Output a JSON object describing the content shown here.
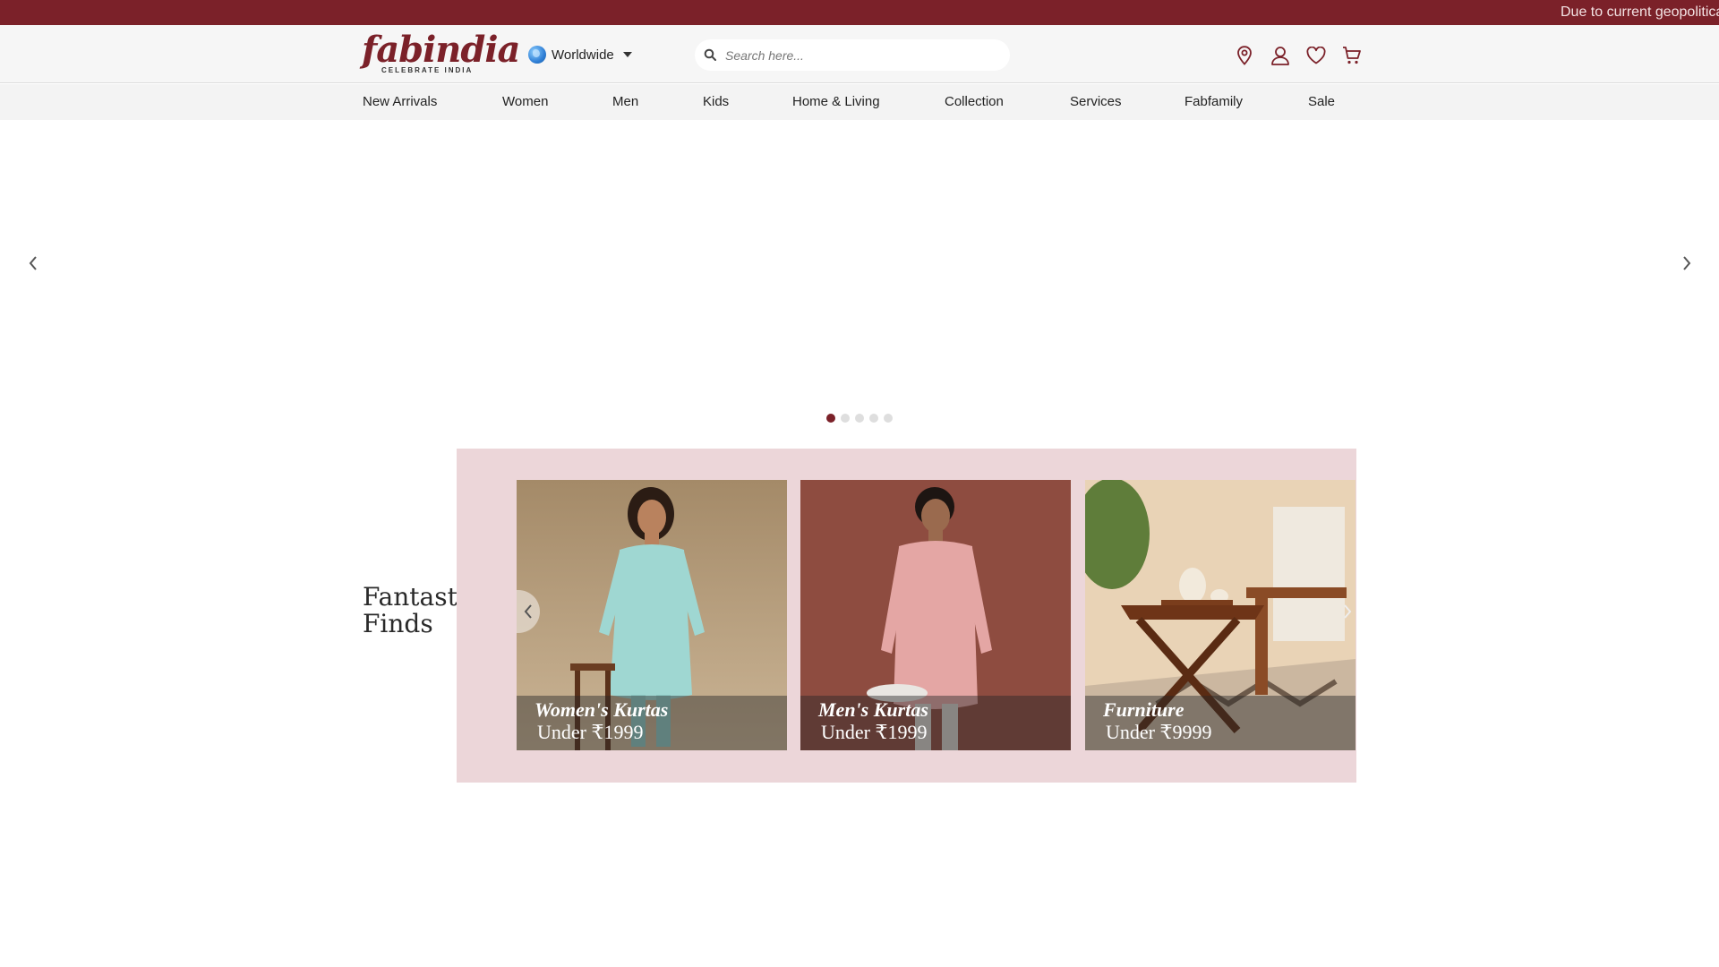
{
  "announcement": {
    "text": "Due to current geopolitical"
  },
  "header": {
    "logo": {
      "word": "fabindia",
      "tagline": "CELEBRATE INDIA"
    },
    "region": {
      "label": "Worldwide",
      "icon": "globe-icon"
    },
    "search": {
      "placeholder": "Search here...",
      "value": "",
      "icon": "search-icon"
    },
    "icons": [
      "location-pin-icon",
      "user-icon",
      "heart-icon",
      "cart-icon"
    ]
  },
  "nav": {
    "items": [
      {
        "label": "New Arrivals"
      },
      {
        "label": "Women"
      },
      {
        "label": "Men"
      },
      {
        "label": "Kids"
      },
      {
        "label": "Home & Living"
      },
      {
        "label": "Collection"
      },
      {
        "label": "Services"
      },
      {
        "label": "Fabfamily"
      },
      {
        "label": "Sale"
      }
    ]
  },
  "hero": {
    "prev_icon": "chevron-left-icon",
    "next_icon": "chevron-right-icon",
    "slide_count": 5,
    "active_slide": 1
  },
  "fantastic_finds": {
    "title_line1": "Fantastic",
    "title_line2": "Finds",
    "cards": [
      {
        "title": "Women's Kurtas",
        "subtitle": "Under ₹1999"
      },
      {
        "title": "Men's Kurtas",
        "subtitle": "Under ₹1999"
      },
      {
        "title": "Furniture",
        "subtitle": "Under ₹9999"
      }
    ],
    "prev_icon": "chevron-left-icon",
    "next_icon": "chevron-right-icon"
  },
  "colors": {
    "brand": "#7b2129",
    "announcement_bg": "#7b2129",
    "finds_panel_bg": "#ecd6d9"
  }
}
